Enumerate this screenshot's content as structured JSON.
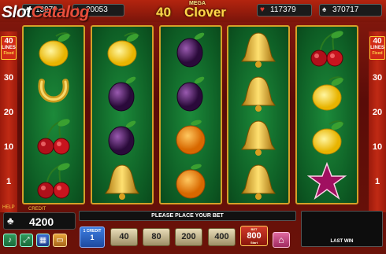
{
  "header": {
    "jackpots": [
      {
        "suit": "club",
        "glyph": "♣",
        "value": "13979"
      },
      {
        "suit": "diamond",
        "glyph": "♦",
        "value": "20053"
      },
      {
        "suit": "heart",
        "glyph": "♥",
        "value": "117379"
      },
      {
        "suit": "spade",
        "glyph": "♠",
        "value": "370717"
      }
    ],
    "logo": {
      "number": "40",
      "mega": "MEGA",
      "name": "Clover"
    },
    "watermark": {
      "part1": "Slot",
      "part2": "Catalog"
    }
  },
  "sidebar": {
    "lines_badge": {
      "number": "40",
      "label": "LINES",
      "sub": "Fixed"
    },
    "line_numbers": [
      "30",
      "20",
      "10",
      "1"
    ],
    "help": "HELP"
  },
  "reels": [
    [
      "lemon",
      "horseshoe",
      "cherries",
      "cherries"
    ],
    [
      "lemon",
      "plum",
      "plum",
      "bell"
    ],
    [
      "plum",
      "plum",
      "orange",
      "orange"
    ],
    [
      "bell",
      "bell",
      "bell",
      "bell"
    ],
    [
      "cherries",
      "lemon",
      "lemon",
      "star"
    ]
  ],
  "footer": {
    "credit_label": "CREDIT",
    "balance": "4200",
    "balance_suit": "♣",
    "message": "PLEASE PLACE YOUR BET",
    "last_win": "LAST WIN",
    "credit_button": {
      "label": "1 CREDIT",
      "value": "1"
    },
    "bets": [
      "40",
      "80",
      "200",
      "400"
    ],
    "active_bet": {
      "label": "BET",
      "value": "800",
      "start": "Start"
    }
  },
  "colors": {
    "felt": "#0e5e25",
    "frame": "#d4a028",
    "panel": "#8a1a0e"
  }
}
